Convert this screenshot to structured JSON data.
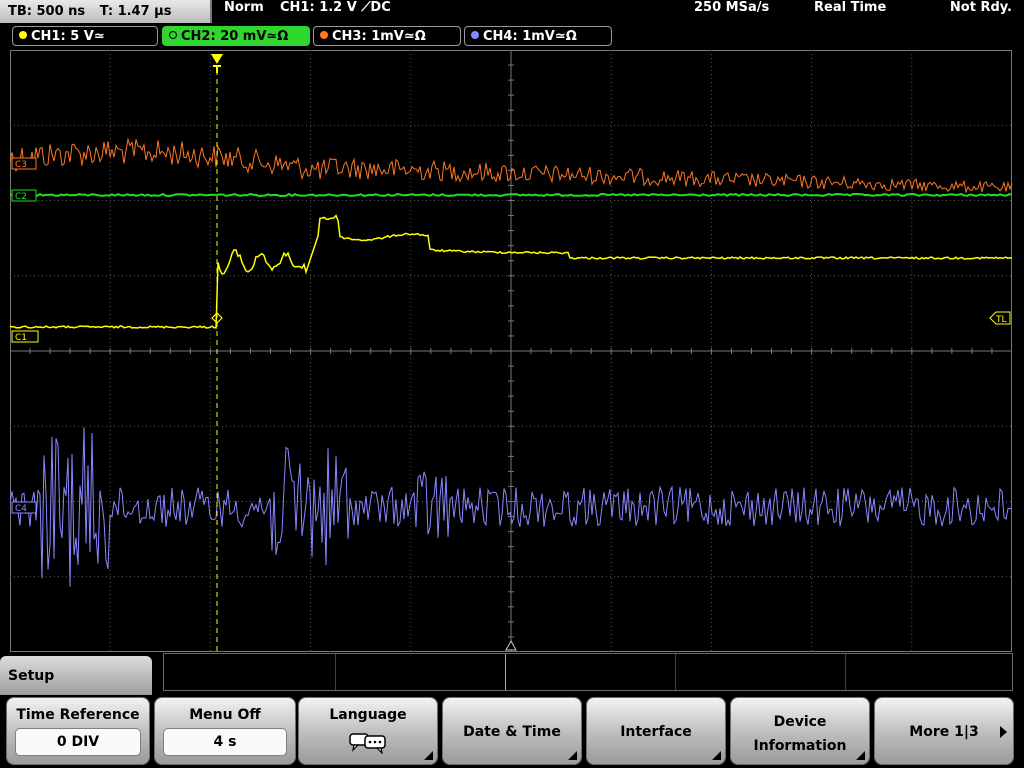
{
  "status_bar": {
    "timebase": "TB: 500 ns",
    "trigger_time": "T: 1.47 µs",
    "trigger_mode": "Norm",
    "trigger_setting": "CH1: 1.2 V ⟋DC",
    "sample_rate": "250 MSa/s",
    "acquisition": "Real Time",
    "state": "Not Rdy."
  },
  "channels": [
    {
      "id": "ch1",
      "label": "CH1: 5 V≃",
      "color": "#ffff00",
      "active": false
    },
    {
      "id": "ch2",
      "label": "CH2: 20 mV≃Ω",
      "color": "#22dd22",
      "active": true
    },
    {
      "id": "ch3",
      "label": "CH3: 1mV≃Ω",
      "color": "#ff7722",
      "active": false
    },
    {
      "id": "ch4",
      "label": "CH4: 1mV≃Ω",
      "color": "#8888ff",
      "active": false
    }
  ],
  "markers": {
    "ch3": "C3",
    "ch2": "C2",
    "ch1": "C1",
    "ch4": "C4",
    "trigger_level": "TL"
  },
  "menu": {
    "title": "Setup",
    "softkeys": [
      {
        "id": "time_reference",
        "label": "Time Reference",
        "value": "0 DIV"
      },
      {
        "id": "menu_off",
        "label": "Menu Off",
        "value": "4 s"
      },
      {
        "id": "language",
        "label": "Language",
        "icon": "speech-bubble-icon"
      },
      {
        "id": "date_time",
        "label": "Date & Time"
      },
      {
        "id": "interface",
        "label": "Interface"
      },
      {
        "id": "device_information",
        "label_line1": "Device",
        "label_line2": "Information"
      },
      {
        "id": "more",
        "label": "More 1|3"
      }
    ]
  },
  "colors": {
    "ch1": "#ffff00",
    "ch2": "#22dd22",
    "ch3": "#ff7722",
    "ch4": "#8888ff",
    "grid": "#5a5a5a"
  }
}
